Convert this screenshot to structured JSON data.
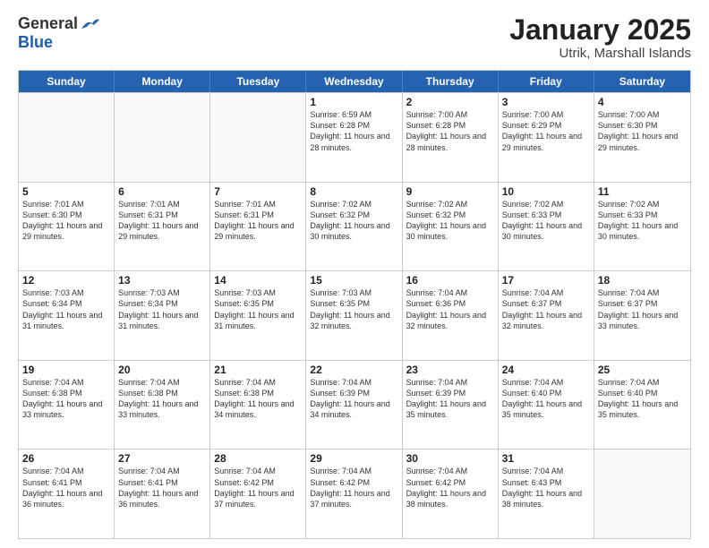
{
  "logo": {
    "general": "General",
    "blue": "Blue"
  },
  "title": {
    "month": "January 2025",
    "location": "Utrik, Marshall Islands"
  },
  "header": {
    "days": [
      "Sunday",
      "Monday",
      "Tuesday",
      "Wednesday",
      "Thursday",
      "Friday",
      "Saturday"
    ]
  },
  "weeks": [
    {
      "cells": [
        {
          "day": "",
          "content": "",
          "empty": true
        },
        {
          "day": "",
          "content": "",
          "empty": true
        },
        {
          "day": "",
          "content": "",
          "empty": true
        },
        {
          "day": "1",
          "content": "Sunrise: 6:59 AM\nSunset: 6:28 PM\nDaylight: 11 hours and 28 minutes.",
          "empty": false
        },
        {
          "day": "2",
          "content": "Sunrise: 7:00 AM\nSunset: 6:28 PM\nDaylight: 11 hours and 28 minutes.",
          "empty": false
        },
        {
          "day": "3",
          "content": "Sunrise: 7:00 AM\nSunset: 6:29 PM\nDaylight: 11 hours and 29 minutes.",
          "empty": false
        },
        {
          "day": "4",
          "content": "Sunrise: 7:00 AM\nSunset: 6:30 PM\nDaylight: 11 hours and 29 minutes.",
          "empty": false
        }
      ]
    },
    {
      "cells": [
        {
          "day": "5",
          "content": "Sunrise: 7:01 AM\nSunset: 6:30 PM\nDaylight: 11 hours and 29 minutes.",
          "empty": false
        },
        {
          "day": "6",
          "content": "Sunrise: 7:01 AM\nSunset: 6:31 PM\nDaylight: 11 hours and 29 minutes.",
          "empty": false
        },
        {
          "day": "7",
          "content": "Sunrise: 7:01 AM\nSunset: 6:31 PM\nDaylight: 11 hours and 29 minutes.",
          "empty": false
        },
        {
          "day": "8",
          "content": "Sunrise: 7:02 AM\nSunset: 6:32 PM\nDaylight: 11 hours and 30 minutes.",
          "empty": false
        },
        {
          "day": "9",
          "content": "Sunrise: 7:02 AM\nSunset: 6:32 PM\nDaylight: 11 hours and 30 minutes.",
          "empty": false
        },
        {
          "day": "10",
          "content": "Sunrise: 7:02 AM\nSunset: 6:33 PM\nDaylight: 11 hours and 30 minutes.",
          "empty": false
        },
        {
          "day": "11",
          "content": "Sunrise: 7:02 AM\nSunset: 6:33 PM\nDaylight: 11 hours and 30 minutes.",
          "empty": false
        }
      ]
    },
    {
      "cells": [
        {
          "day": "12",
          "content": "Sunrise: 7:03 AM\nSunset: 6:34 PM\nDaylight: 11 hours and 31 minutes.",
          "empty": false
        },
        {
          "day": "13",
          "content": "Sunrise: 7:03 AM\nSunset: 6:34 PM\nDaylight: 11 hours and 31 minutes.",
          "empty": false
        },
        {
          "day": "14",
          "content": "Sunrise: 7:03 AM\nSunset: 6:35 PM\nDaylight: 11 hours and 31 minutes.",
          "empty": false
        },
        {
          "day": "15",
          "content": "Sunrise: 7:03 AM\nSunset: 6:35 PM\nDaylight: 11 hours and 32 minutes.",
          "empty": false
        },
        {
          "day": "16",
          "content": "Sunrise: 7:04 AM\nSunset: 6:36 PM\nDaylight: 11 hours and 32 minutes.",
          "empty": false
        },
        {
          "day": "17",
          "content": "Sunrise: 7:04 AM\nSunset: 6:37 PM\nDaylight: 11 hours and 32 minutes.",
          "empty": false
        },
        {
          "day": "18",
          "content": "Sunrise: 7:04 AM\nSunset: 6:37 PM\nDaylight: 11 hours and 33 minutes.",
          "empty": false
        }
      ]
    },
    {
      "cells": [
        {
          "day": "19",
          "content": "Sunrise: 7:04 AM\nSunset: 6:38 PM\nDaylight: 11 hours and 33 minutes.",
          "empty": false
        },
        {
          "day": "20",
          "content": "Sunrise: 7:04 AM\nSunset: 6:38 PM\nDaylight: 11 hours and 33 minutes.",
          "empty": false
        },
        {
          "day": "21",
          "content": "Sunrise: 7:04 AM\nSunset: 6:38 PM\nDaylight: 11 hours and 34 minutes.",
          "empty": false
        },
        {
          "day": "22",
          "content": "Sunrise: 7:04 AM\nSunset: 6:39 PM\nDaylight: 11 hours and 34 minutes.",
          "empty": false
        },
        {
          "day": "23",
          "content": "Sunrise: 7:04 AM\nSunset: 6:39 PM\nDaylight: 11 hours and 35 minutes.",
          "empty": false
        },
        {
          "day": "24",
          "content": "Sunrise: 7:04 AM\nSunset: 6:40 PM\nDaylight: 11 hours and 35 minutes.",
          "empty": false
        },
        {
          "day": "25",
          "content": "Sunrise: 7:04 AM\nSunset: 6:40 PM\nDaylight: 11 hours and 35 minutes.",
          "empty": false
        }
      ]
    },
    {
      "cells": [
        {
          "day": "26",
          "content": "Sunrise: 7:04 AM\nSunset: 6:41 PM\nDaylight: 11 hours and 36 minutes.",
          "empty": false
        },
        {
          "day": "27",
          "content": "Sunrise: 7:04 AM\nSunset: 6:41 PM\nDaylight: 11 hours and 36 minutes.",
          "empty": false
        },
        {
          "day": "28",
          "content": "Sunrise: 7:04 AM\nSunset: 6:42 PM\nDaylight: 11 hours and 37 minutes.",
          "empty": false
        },
        {
          "day": "29",
          "content": "Sunrise: 7:04 AM\nSunset: 6:42 PM\nDaylight: 11 hours and 37 minutes.",
          "empty": false
        },
        {
          "day": "30",
          "content": "Sunrise: 7:04 AM\nSunset: 6:42 PM\nDaylight: 11 hours and 38 minutes.",
          "empty": false
        },
        {
          "day": "31",
          "content": "Sunrise: 7:04 AM\nSunset: 6:43 PM\nDaylight: 11 hours and 38 minutes.",
          "empty": false
        },
        {
          "day": "",
          "content": "",
          "empty": true
        }
      ]
    }
  ]
}
